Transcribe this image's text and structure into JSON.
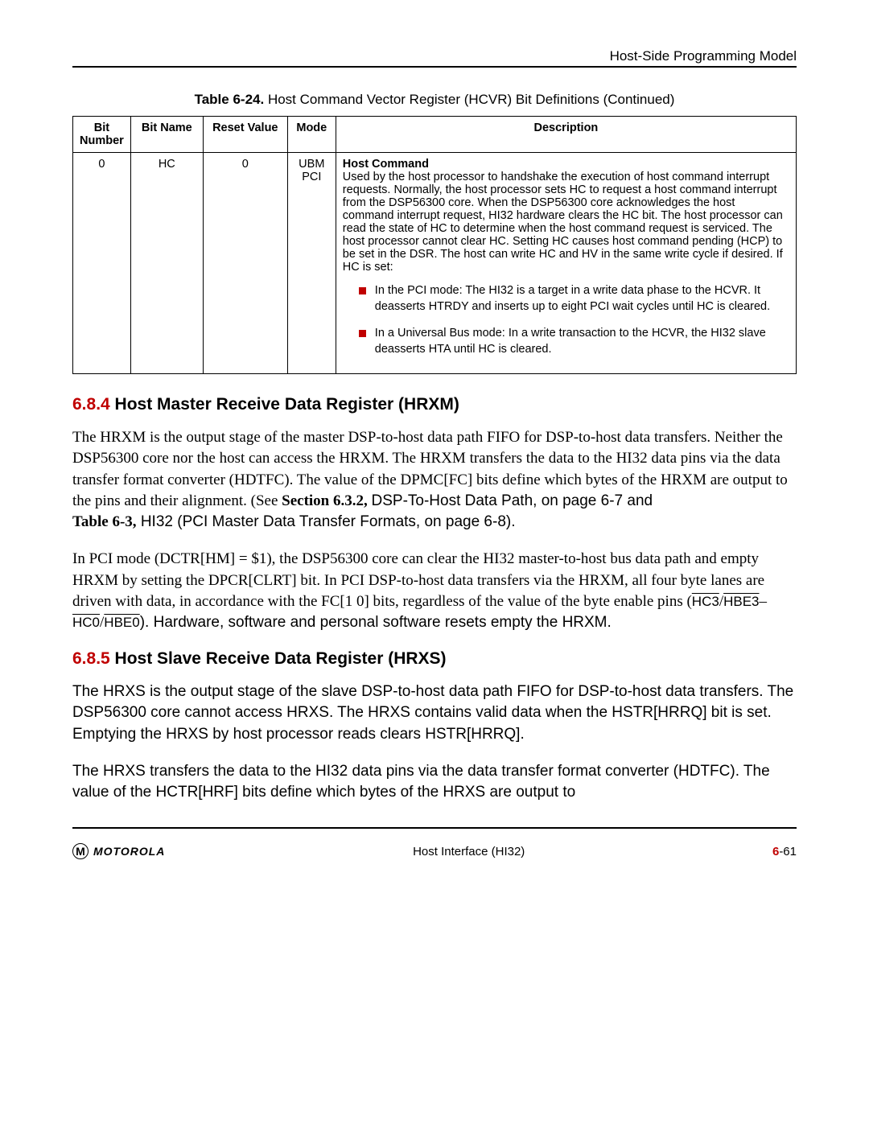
{
  "header": {
    "section": "Host-Side Programming Model"
  },
  "table": {
    "caption_label": "Table 6-24.",
    "caption_text": " Host Command Vector Register (HCVR) Bit Definitions (Continued)",
    "columns": [
      "Bit Number",
      "Bit Name",
      "Reset Value",
      "Mode",
      "Description"
    ],
    "row": {
      "bit_number": "0",
      "bit_name": "HC",
      "reset_value": "0",
      "mode_line1": "UBM",
      "mode_line2": "PCI",
      "desc_title": "Host Command",
      "desc_body": "Used by the host processor to handshake the execution of host command interrupt requests. Normally, the host processor sets HC to request a host command interrupt from the DSP56300 core. When the DSP56300 core acknowledges the host command interrupt request, HI32 hardware clears the HC bit. The host processor can read the state of HC to determine when the host command request is serviced. The host processor cannot clear HC. Setting HC causes host command pending (HCP) to be set in the DSR. The host can write HC and HV in the same write cycle if desired. If HC is set:",
      "bullet1": "In the PCI mode: The HI32 is a target in a write data phase to the HCVR. It deasserts HTRDY and inserts up to eight PCI wait cycles until HC is cleared.",
      "bullet2": "In a Universal Bus mode: In a write transaction to the HCVR, the HI32 slave deasserts HTA until HC is cleared."
    }
  },
  "section684": {
    "num": "6.8.4",
    "title": " Host Master Receive Data Register (HRXM)",
    "p1_a": "The HRXM is the output stage of the master DSP-to-host data path FIFO for DSP-to-host data transfers. Neither the DSP56300 core nor the host can access the HRXM. The HRXM transfers the data to the HI32 data pins via the data transfer format converter (HDTFC). The value of the DPMC[FC] bits define which bytes of the HRXM are output to the pins and their alignment. (See ",
    "p1_bold1": "Section 6.3.2, ",
    "p1_b": " DSP-To-Host Data Path, on page 6-7 and ",
    "p1_bold2": "Table 6-3,",
    "p1_c": " HI32 (PCI Master Data Transfer Formats, on page 6-8).",
    "p2_a": "In PCI mode (DCTR[HM] = $1), the DSP56300 core can clear the HI32 master-to-host bus data path and empty HRXM by setting the DPCR[CLRT] bit. In PCI DSP-to-host data transfers via the HRXM, all four byte lanes are driven with data, in accordance with the FC[1 0] bits, regardless of the value of the byte enable pins (",
    "p2_ov1": "HC3",
    "p2_mid1": "/",
    "p2_ov2": "HBE3",
    "p2_mid2": "–",
    "p2_ov3": "HC0",
    "p2_mid3": "/",
    "p2_ov4": "HBE0",
    "p2_b": "). Hardware, software and personal software resets empty the HRXM."
  },
  "section685": {
    "num": "6.8.5",
    "title": " Host Slave Receive Data Register (HRXS)",
    "p1": "The HRXS is the output stage of the slave DSP-to-host data path FIFO for DSP-to-host data transfers. The DSP56300 core cannot access HRXS. The HRXS contains valid data when the HSTR[HRRQ] bit is set. Emptying the HRXS by host processor reads clears HSTR[HRRQ].",
    "p2": "The HRXS transfers the data to the HI32 data pins via the data transfer format converter (HDTFC). The value of the HCTR[HRF] bits define which bytes of the HRXS are output to"
  },
  "footer": {
    "logo_letter": "M",
    "brand": "MOTOROLA",
    "center": "Host Interface (HI32)",
    "page_chapter": "6",
    "page_num": "-61"
  }
}
